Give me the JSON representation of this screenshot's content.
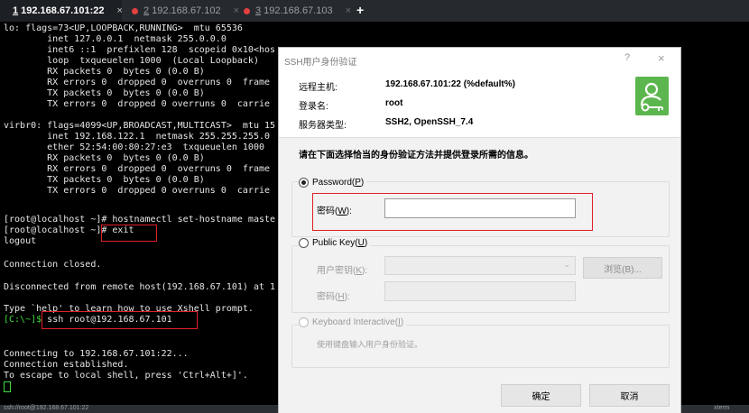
{
  "tabs": [
    {
      "num": "1",
      "label": "192.168.67.101:22",
      "color": "#22c55e",
      "active": true
    },
    {
      "num": "2",
      "label": "192.168.67.102",
      "color": "#e34040",
      "active": false
    },
    {
      "num": "3",
      "label": "192.168.67.103",
      "color": "#e34040",
      "active": false
    }
  ],
  "add_tab": "+",
  "terminal": {
    "lines": [
      "lo: flags=73<UP,LOOPBACK,RUNNING>  mtu 65536",
      "        inet 127.0.0.1  netmask 255.0.0.0",
      "        inet6 ::1  prefixlen 128  scopeid 0x10<hos",
      "        loop  txqueuelen 1000  (Local Loopback)",
      "        RX packets 0  bytes 0 (0.0 B)",
      "        RX errors 0  dropped 0  overruns 0  frame",
      "        TX packets 0  bytes 0 (0.0 B)",
      "        TX errors 0  dropped 0 overruns 0  carrie",
      "",
      "virbr0: flags=4099<UP,BROADCAST,MULTICAST>  mtu 15",
      "        inet 192.168.122.1  netmask 255.255.255.0",
      "        ether 52:54:00:80:27:e3  txqueuelen 1000",
      "        RX packets 0  bytes 0 (0.0 B)",
      "        RX errors 0  dropped 0  overruns 0  frame",
      "        TX packets 0  bytes 0 (0.0 B)",
      "        TX errors 0  dropped 0 overruns 0  carrie",
      "",
      "[root@localhost ~]# hostnamectl set-hostname maste",
      "[root@localhost ~]# exit",
      "logout",
      "",
      "Connection closed.",
      "",
      "Disconnected from remote host(192.168.67.101) at 1",
      "",
      "Type `help' to learn how to use Xshell prompt.",
      "ssh root@192.168.67.101",
      "",
      "",
      "Connecting to 192.168.67.101:22...",
      "Connection established.",
      "To escape to local shell, press 'Ctrl+Alt+]'."
    ],
    "prompt": "[C:\\~]$ "
  },
  "status_bar": {
    "left": "ssh://root@192.168.67.101:22",
    "right": "xterm"
  },
  "dialog": {
    "title": "SSH用户身份验证",
    "help": "?",
    "close": "×",
    "info": [
      {
        "label": "远程主机:",
        "value": "192.168.67.101:22 (%default%)"
      },
      {
        "label": "登录名:",
        "value": "root"
      },
      {
        "label": "服务器类型:",
        "value": "SSH2, OpenSSH_7.4"
      }
    ],
    "instruction": "请在下面选择恰当的身份验证方法并提供登录所需的信息。",
    "password": {
      "option": "Password(",
      "key": "P",
      "close": ")",
      "field_label": "密码(",
      "field_key": "W",
      "field_close": "):",
      "value": ""
    },
    "public_key": {
      "option": "Public Key(",
      "key": "U",
      "close": ")",
      "user_key_label": "用户密钥(",
      "user_key_key": "K",
      "user_key_close": "):",
      "browse": "浏览(B)...",
      "passphrase_label": "密码(",
      "passphrase_key": "H",
      "passphrase_close": "):"
    },
    "keyboard": {
      "option": "Keyboard Interactive(",
      "key": "I",
      "close": ")",
      "hint": "使用键盘输入用户身份验证。"
    },
    "ok": "确定",
    "cancel": "取消",
    "icon_color": "#5cb64e"
  }
}
